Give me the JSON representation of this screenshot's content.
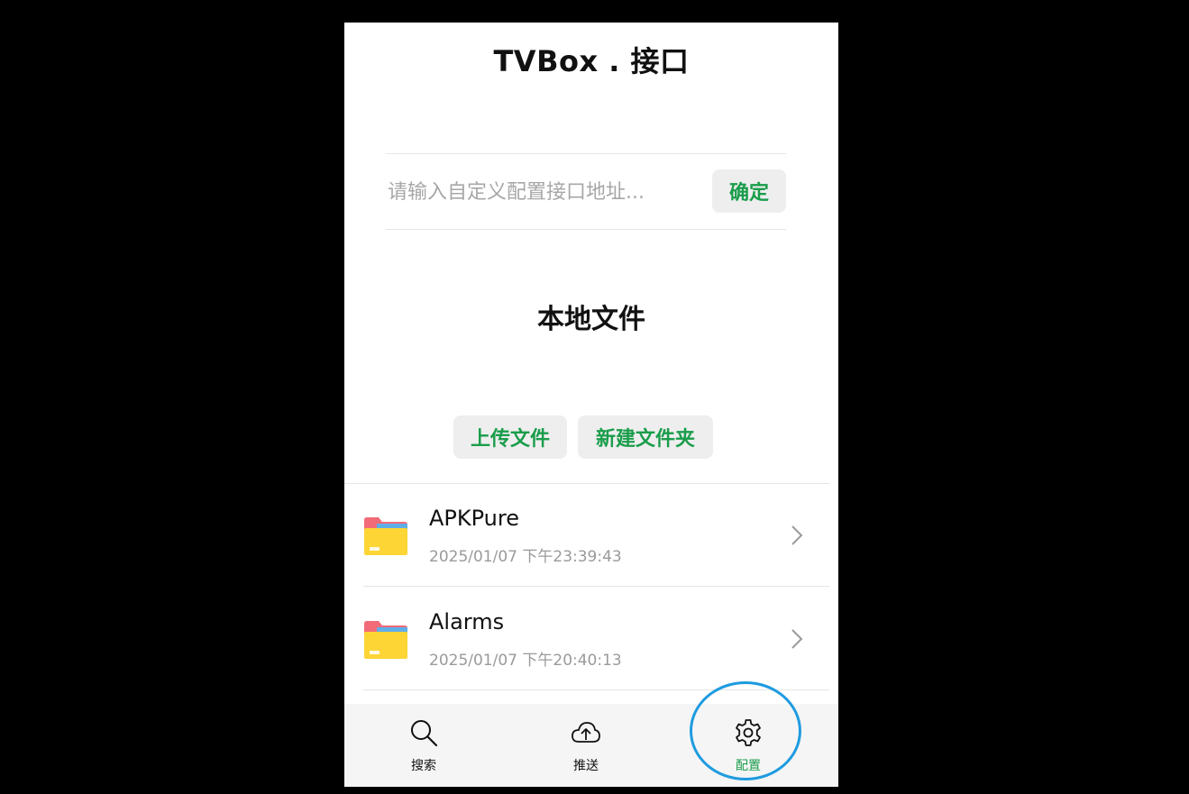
{
  "header": {
    "title": "TVBox . 接口"
  },
  "config": {
    "input_value": "",
    "input_placeholder": "请输入自定义配置接口地址...",
    "confirm_label": "确定"
  },
  "local_files": {
    "title": "本地文件",
    "upload_label": "上传文件",
    "new_folder_label": "新建文件夹",
    "items": [
      {
        "name": "APKPure",
        "date": "2025/01/07 下午23:39:43",
        "icon": "folder-icon"
      },
      {
        "name": "Alarms",
        "date": "2025/01/07 下午20:40:13",
        "icon": "folder-icon"
      }
    ]
  },
  "tabbar": {
    "active": "config",
    "tabs": [
      {
        "id": "search",
        "label": "搜索",
        "icon": "search-icon"
      },
      {
        "id": "push",
        "label": "推送",
        "icon": "cloud-upload-icon"
      },
      {
        "id": "config",
        "label": "配置",
        "icon": "gear-icon"
      }
    ]
  },
  "colors": {
    "accent": "#1a9d4b",
    "highlight_ring": "#1e9be0",
    "background": "#000000",
    "folder_body": "#fdd535",
    "folder_tab": "#f26b78",
    "folder_paper": "#5faee8"
  }
}
